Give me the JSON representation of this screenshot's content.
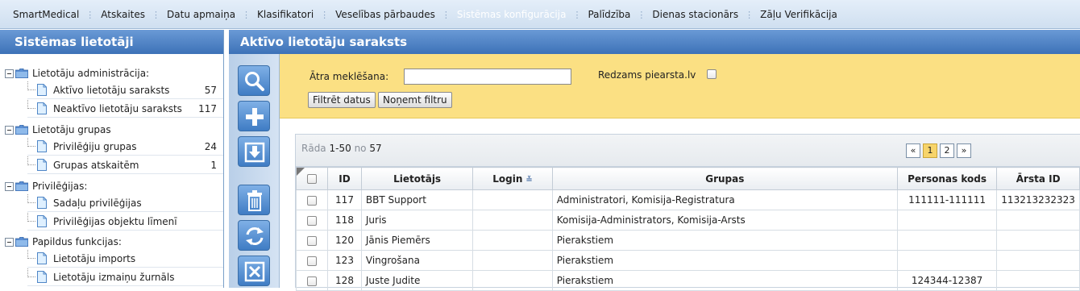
{
  "menu": [
    {
      "label": "SmartMedical",
      "active": false
    },
    {
      "label": "Atskaites",
      "active": false
    },
    {
      "label": "Datu apmaiņa",
      "active": false
    },
    {
      "label": "Klasifikatori",
      "active": false
    },
    {
      "label": "Veselības pārbaudes",
      "active": false
    },
    {
      "label": "Sistēmas konfigurācija",
      "active": true
    },
    {
      "label": "Palīdzība",
      "active": false
    },
    {
      "label": "Dienas stacionārs",
      "active": false
    },
    {
      "label": "Zāļu Verifikācija",
      "active": false
    }
  ],
  "left": {
    "title": "Sistēmas lietotāji",
    "groups": [
      {
        "label": "Lietotāju administrācija:",
        "items": [
          {
            "label": "Aktīvo lietotāju saraksts",
            "count": "57"
          },
          {
            "label": "Neaktīvo lietotāju saraksts",
            "count": "117"
          }
        ]
      },
      {
        "label": "Lietotāju grupas",
        "items": [
          {
            "label": "Privilēģiju grupas",
            "count": "24"
          },
          {
            "label": "Grupas atskaitēm",
            "count": "1"
          }
        ]
      },
      {
        "label": "Privilēģijas:",
        "items": [
          {
            "label": "Sadaļu privilēģijas",
            "count": ""
          },
          {
            "label": "Privilēģijas objektu līmenī",
            "count": ""
          }
        ]
      },
      {
        "label": "Papildus funkcijas:",
        "items": [
          {
            "label": "Lietotāju imports",
            "count": ""
          },
          {
            "label": "Lietotāju izmaiņu žurnāls",
            "count": ""
          }
        ]
      }
    ]
  },
  "main": {
    "title": "Aktīvo lietotāju saraksts",
    "toolbar_icons": [
      "search-icon",
      "add-icon",
      "download-icon",
      "delete-icon",
      "refresh-icon",
      "excel-icon"
    ],
    "filter": {
      "quick_search_label": "Ātra meklēšana:",
      "quick_search_value": "",
      "visible_label": "Redzams piearsta.lv",
      "filter_button": "Filtrēt datus",
      "clear_button": "Noņemt filtru"
    },
    "grid": {
      "showing_prefix": "Rāda",
      "showing_range": "1-50",
      "showing_of": "no",
      "showing_total": "57",
      "pager": {
        "first": "«",
        "pages": [
          "1",
          "2"
        ],
        "current": "1",
        "next": "»"
      },
      "columns": [
        "ID",
        "Lietotājs",
        "Login",
        "Grupas",
        "Personas kods",
        "Ārsta ID"
      ],
      "rows": [
        {
          "id": "117",
          "user": "BBT Support",
          "login": "",
          "groups": "Administratori, Komisija-Registratura",
          "personal_code": "111111-111111",
          "doctor_id": "113213232323"
        },
        {
          "id": "118",
          "user": "Juris",
          "login": "",
          "groups": "Komisija-Administrators, Komisija-Arsts",
          "personal_code": "",
          "doctor_id": ""
        },
        {
          "id": "120",
          "user": "Jānis Piemērs",
          "login": "",
          "groups": "Pierakstiem",
          "personal_code": "",
          "doctor_id": ""
        },
        {
          "id": "123",
          "user": "Vingrošana",
          "login": "",
          "groups": "Pierakstiem",
          "personal_code": "",
          "doctor_id": ""
        },
        {
          "id": "128",
          "user": "Juste Judite",
          "login": "",
          "groups": "Pierakstiem",
          "personal_code": "124344-12387",
          "doctor_id": ""
        }
      ]
    }
  }
}
